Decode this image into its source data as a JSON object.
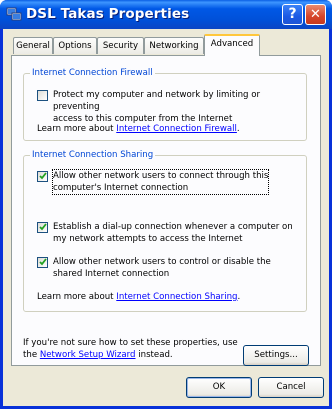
{
  "window": {
    "title": "DSL Takas Properties",
    "help_button": "?",
    "close_button": "✕"
  },
  "tabs": [
    {
      "label": "General",
      "active": false
    },
    {
      "label": "Options",
      "active": false
    },
    {
      "label": "Security",
      "active": false
    },
    {
      "label": "Networking",
      "active": false
    },
    {
      "label": "Advanced",
      "active": true
    }
  ],
  "firewall": {
    "legend": "Internet Connection Firewall",
    "protect_label_line1": "Protect my computer and network by limiting or preventing",
    "protect_label_line2": "access to this computer from the Internet",
    "protect_checked": false,
    "learn_prefix": "Learn more about ",
    "learn_link": "Internet Connection Firewall",
    "learn_suffix": "."
  },
  "sharing": {
    "legend": "Internet Connection Sharing",
    "allow_connect_line1": "Allow other network users to connect through this",
    "allow_connect_line2": "computer's Internet connection",
    "allow_connect_checked": true,
    "dialup_line1": "Establish a dial-up connection whenever a computer on",
    "dialup_line2": "my network attempts to access the Internet",
    "dialup_checked": true,
    "control_line1": "Allow other network users to control or disable the",
    "control_line2": "shared Internet connection",
    "control_checked": true,
    "learn_prefix": "Learn more about ",
    "learn_link": "Internet Connection Sharing",
    "learn_suffix": "."
  },
  "footer": {
    "text_line1": "If you're not sure how to set these properties, use",
    "text_prefix2": "the ",
    "wizard_link": "Network Setup Wizard",
    "text_suffix2": " instead.",
    "settings_button": "Settings..."
  },
  "dialog_buttons": {
    "ok": "OK",
    "cancel": "Cancel"
  }
}
